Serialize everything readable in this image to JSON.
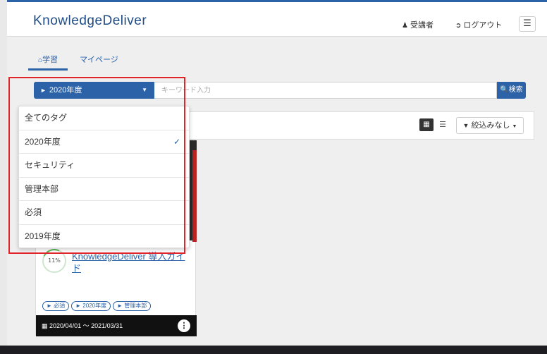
{
  "header": {
    "logo_text": "KnowledgeDeliver",
    "student_label": "受講者",
    "logout_label": "ログアウト",
    "menu_icon": "hamburger-icon"
  },
  "nav": {
    "tabs": [
      {
        "label": "学習",
        "icon": "home-icon",
        "active": true
      },
      {
        "label": "マイページ",
        "active": false
      }
    ]
  },
  "search": {
    "tag_selected": "2020年度",
    "keyword_placeholder": "キーワード入力",
    "search_label": "検索"
  },
  "toolbar": {
    "filter_label": "絞込みなし"
  },
  "dropdown": {
    "items": [
      {
        "label": "全てのタグ",
        "checked": false
      },
      {
        "label": "2020年度",
        "checked": true
      },
      {
        "label": "セキュリティ",
        "checked": false
      },
      {
        "label": "管理本部",
        "checked": false
      },
      {
        "label": "必須",
        "checked": false
      },
      {
        "label": "2019年度",
        "checked": false
      }
    ]
  },
  "card": {
    "progress": "11%",
    "title": "KnowledgeDeliver 導入ガイド",
    "tags": [
      "必須",
      "2020年度",
      "管理本部"
    ],
    "period": "2020/04/01 ～ 2021/03/31"
  },
  "colors": {
    "accent": "#2b62a8",
    "highlight": "#e0242a",
    "progress": "#5cb85c"
  }
}
